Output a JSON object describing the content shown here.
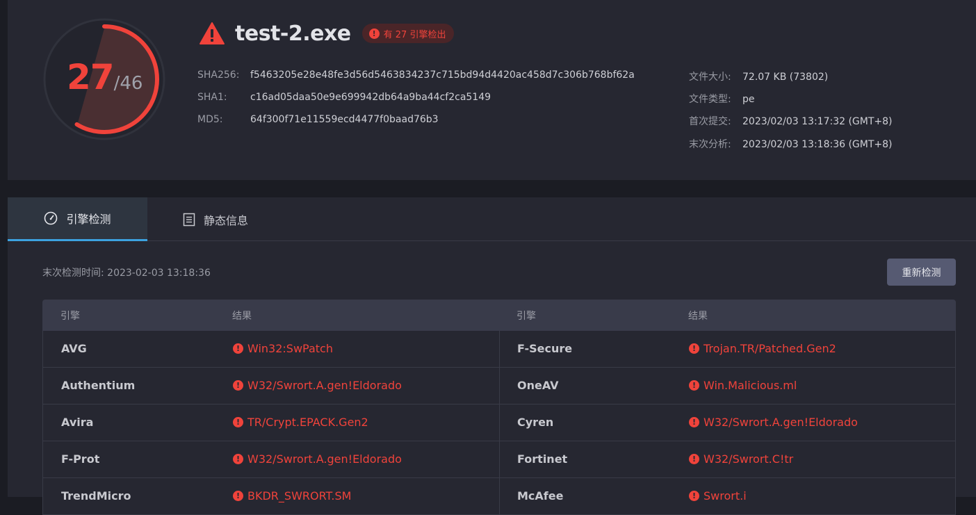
{
  "summary": {
    "detected": "27",
    "total": "/46",
    "detection_ratio": 0.587,
    "filename": "test-2.exe",
    "badge": "有 27 引擎检出",
    "hashes": [
      {
        "label": "SHA256:",
        "value": "f5463205e28e48fe3d56d5463834237c715bd94d4420ac458d7c306b768bf62a"
      },
      {
        "label": "SHA1:",
        "value": "c16ad05daa50e9e699942db64a9ba44cf2ca5149"
      },
      {
        "label": "MD5:",
        "value": "64f300f71e11559ecd4477f0baad76b3"
      }
    ],
    "meta": [
      {
        "label": "文件大小:",
        "value": "72.07 KB (73802)"
      },
      {
        "label": "文件类型:",
        "value": "pe"
      },
      {
        "label": "首次提交:",
        "value": "2023/02/03 13:17:32 (GMT+8)"
      },
      {
        "label": "末次分析:",
        "value": "2023/02/03 13:18:36 (GMT+8)"
      }
    ]
  },
  "tabs": [
    {
      "label": "引擎检测",
      "icon": "gauge-icon",
      "active": true
    },
    {
      "label": "静态信息",
      "icon": "document-icon",
      "active": false
    }
  ],
  "scan": {
    "last_scan": "末次检测时间: 2023-02-03 13:18:36",
    "rescan_label": "重新检测"
  },
  "table": {
    "headers": [
      "引擎",
      "结果",
      "引擎",
      "结果"
    ],
    "rows": [
      {
        "e1": "AVG",
        "r1": "Win32:SwPatch",
        "e2": "F-Secure",
        "r2": "Trojan.TR/Patched.Gen2"
      },
      {
        "e1": "Authentium",
        "r1": "W32/Swrort.A.gen!Eldorado",
        "e2": "OneAV",
        "r2": "Win.Malicious.ml"
      },
      {
        "e1": "Avira",
        "r1": "TR/Crypt.EPACK.Gen2",
        "e2": "Cyren",
        "r2": "W32/Swrort.A.gen!Eldorado"
      },
      {
        "e1": "F-Prot",
        "r1": "W32/Swrort.A.gen!Eldorado",
        "e2": "Fortinet",
        "r2": "W32/Swrort.C!tr"
      },
      {
        "e1": "TrendMicro",
        "r1": "BKDR_SWRORT.SM",
        "e2": "McAfee",
        "r2": "Swrort.i"
      }
    ]
  },
  "colors": {
    "accent_red": "#f0433b",
    "tab_indicator": "#3ca2e0",
    "panel_bg": "#262731"
  }
}
